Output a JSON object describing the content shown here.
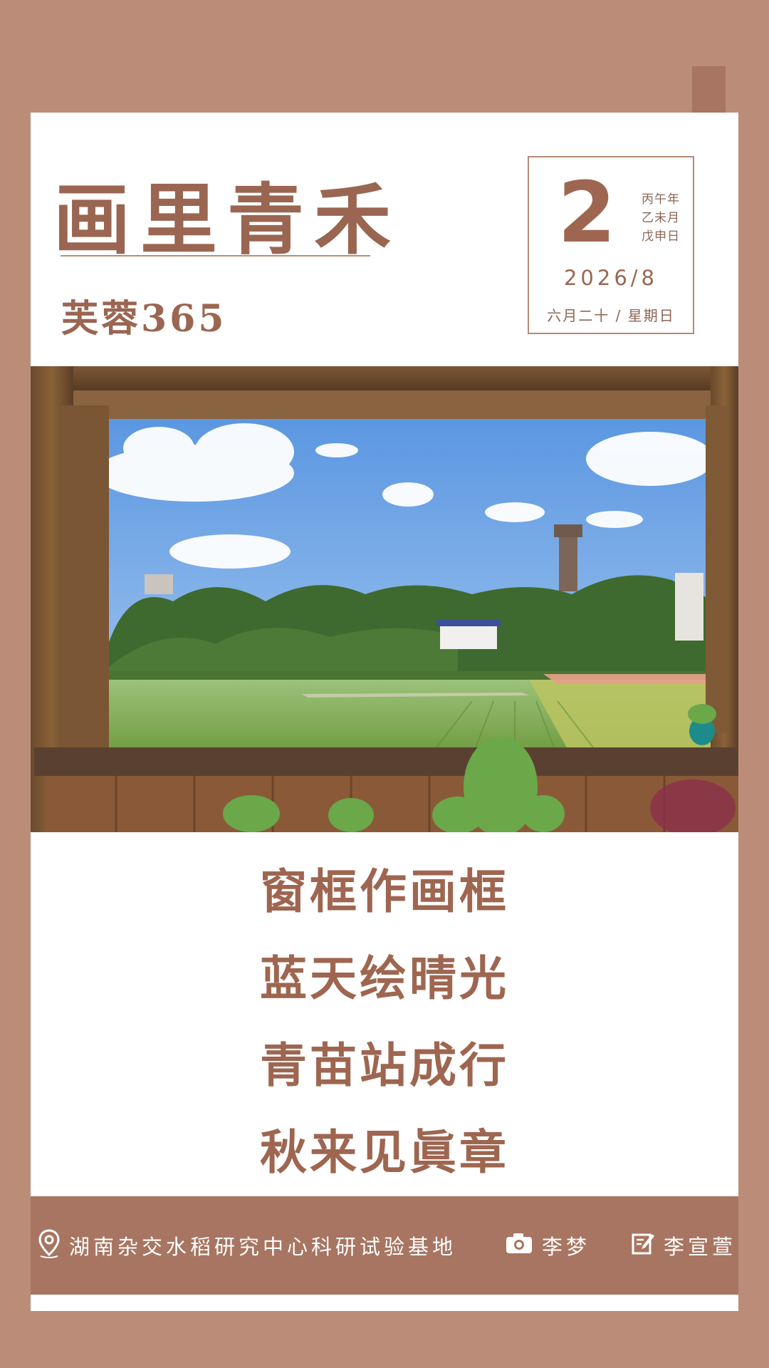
{
  "header": {
    "title": "画里青禾",
    "brand": "芙蓉365"
  },
  "date": {
    "day": "2",
    "lunar_year": "丙午年",
    "lunar_month": "乙未月",
    "lunar_day": "戊申日",
    "year_month": "2026/8",
    "lunar_date_weekday": "六月二十 / 星期日"
  },
  "photo": {
    "scene": "rice paddy seen through a wooden window frame"
  },
  "poem": {
    "lines": [
      "窗框作画框",
      "蓝天绘晴光",
      "青苗站成行",
      "秋来见眞章"
    ]
  },
  "footer": {
    "location": "湖南杂交水稻研究中心科研试验基地",
    "photographer": "李梦",
    "writer": "李宣萱",
    "icons": [
      "location-pin-icon",
      "camera-icon",
      "edit-icon"
    ]
  },
  "colors": {
    "background": "#bb8d79",
    "accent": "#9a6651",
    "footer_bar": "#a77561"
  }
}
